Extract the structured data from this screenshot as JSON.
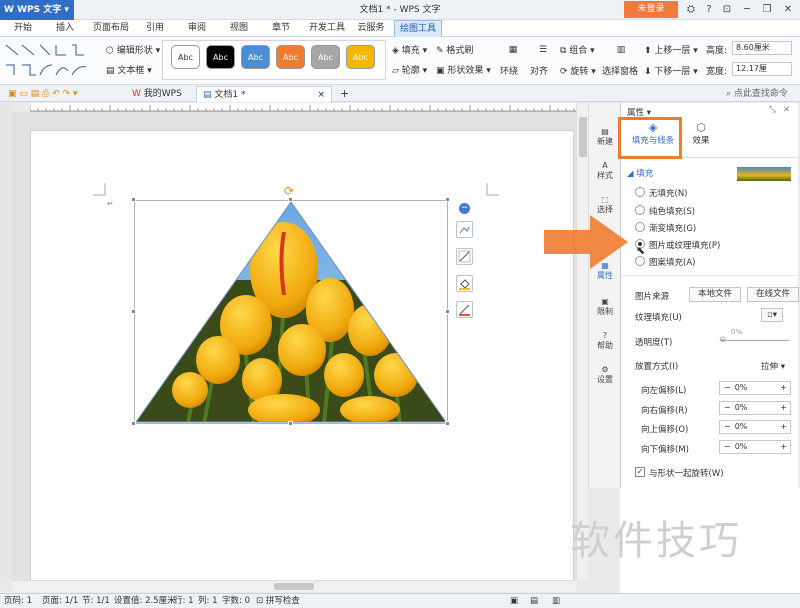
{
  "titlebar": {
    "app_label": "WPS 文字",
    "doc_title": "文档1 * - WPS 文字",
    "login_label": "未登录"
  },
  "menu": {
    "items": [
      "开始",
      "插入",
      "页面布局",
      "引用",
      "审阅",
      "视图",
      "章节",
      "开发工具",
      "云服务",
      "绘图工具"
    ],
    "active": "绘图工具"
  },
  "ribbon": {
    "edit_shape": "编辑形状",
    "text_box": "文本框",
    "swatch_label": "Abc",
    "fill": "填充",
    "format_painter": "格式刷",
    "outline": "轮廓",
    "shape_effect": "形状效果",
    "wrap": "环绕",
    "align": "对齐",
    "rotate": "旋转",
    "combine": "组合",
    "selection_pane": "选择窗格",
    "bring_forward": "上移一层",
    "send_backward": "下移一层",
    "height_label": "高度:",
    "height_value": "8.60厘米",
    "width_label": "宽度:",
    "width_value": "12.17厘"
  },
  "swatch_colors": [
    "#ffffff",
    "#000000",
    "#4a8fd6",
    "#f07d2d",
    "#a5a5a5",
    "#f2b700"
  ],
  "tabs": {
    "my_wps": "我的WPS",
    "doc": "文档1 *",
    "search_placeholder": "点此查找命令"
  },
  "rail": [
    "新建",
    "样式",
    "选择",
    "属性",
    "限制",
    "帮助",
    "设置"
  ],
  "panel": {
    "title": "属性",
    "tab_fill_line": "填充与线条",
    "tab_effect": "效果",
    "section_fill": "填充",
    "options": [
      "无填充(N)",
      "纯色填充(S)",
      "渐变填充(G)",
      "图片或纹理填充(P)",
      "图案填充(A)"
    ],
    "selected_option": "图片或纹理填充(P)",
    "picture_source": "图片来源",
    "local_file": "本地文件",
    "online_file": "在线文件",
    "texture_fill": "纹理填充(U)",
    "transparency": "透明度(T)",
    "transparency_value": "0%",
    "placement": "放置方式(I)",
    "placement_value": "拉伸",
    "offsets": [
      {
        "label": "向左偏移(L)",
        "value": "0%"
      },
      {
        "label": "向右偏移(R)",
        "value": "0%"
      },
      {
        "label": "向上偏移(O)",
        "value": "0%"
      },
      {
        "label": "向下偏移(M)",
        "value": "0%"
      }
    ],
    "rotate_with_shape": "与形状一起旋转(W)"
  },
  "status": {
    "page_num": "页码: 1",
    "pages": "页面: 1/1",
    "section": "节: 1/1",
    "setting": "设置值: 2.5厘米",
    "row": "行: 1",
    "col": "列: 1",
    "words": "字数: 0",
    "spell": "拼写检查"
  },
  "watermark": "软件技巧",
  "accent_orange": "#ef7b2f",
  "accent_blue": "#2f6dc6"
}
